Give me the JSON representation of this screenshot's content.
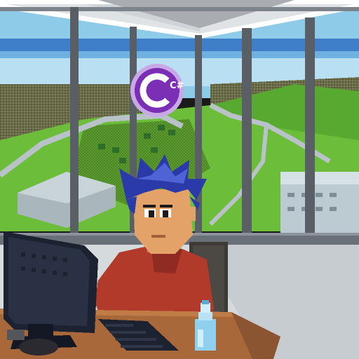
{
  "scene": {
    "badge": {
      "label": "C#",
      "icon": "csharp-logo-icon",
      "color": "#7a2fb5",
      "ring_color": "#c9a8e8"
    },
    "palette": {
      "sky": "#8ecbe8",
      "sky_band": "#3f7ec9",
      "grass": "#6cbe3a",
      "road": "#b9c2c8",
      "window_frame": "#5a5f66",
      "wall": "#d5dadd",
      "desk": "#a8683a",
      "shirt": "#b23a2a",
      "hair": "#2a3aa8",
      "skin": "#e3a368",
      "monitor": "#1d2230",
      "bottle": "#8fd0ee"
    }
  }
}
